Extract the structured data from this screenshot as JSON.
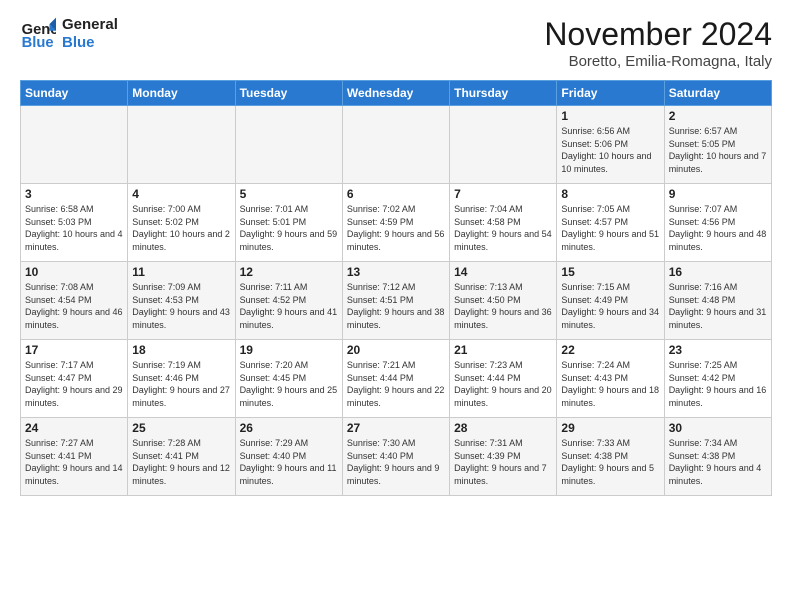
{
  "logo": {
    "line1": "General",
    "line2": "Blue"
  },
  "title": "November 2024",
  "location": "Boretto, Emilia-Romagna, Italy",
  "days_of_week": [
    "Sunday",
    "Monday",
    "Tuesday",
    "Wednesday",
    "Thursday",
    "Friday",
    "Saturday"
  ],
  "weeks": [
    [
      {
        "num": "",
        "info": ""
      },
      {
        "num": "",
        "info": ""
      },
      {
        "num": "",
        "info": ""
      },
      {
        "num": "",
        "info": ""
      },
      {
        "num": "",
        "info": ""
      },
      {
        "num": "1",
        "info": "Sunrise: 6:56 AM\nSunset: 5:06 PM\nDaylight: 10 hours and 10 minutes."
      },
      {
        "num": "2",
        "info": "Sunrise: 6:57 AM\nSunset: 5:05 PM\nDaylight: 10 hours and 7 minutes."
      }
    ],
    [
      {
        "num": "3",
        "info": "Sunrise: 6:58 AM\nSunset: 5:03 PM\nDaylight: 10 hours and 4 minutes."
      },
      {
        "num": "4",
        "info": "Sunrise: 7:00 AM\nSunset: 5:02 PM\nDaylight: 10 hours and 2 minutes."
      },
      {
        "num": "5",
        "info": "Sunrise: 7:01 AM\nSunset: 5:01 PM\nDaylight: 9 hours and 59 minutes."
      },
      {
        "num": "6",
        "info": "Sunrise: 7:02 AM\nSunset: 4:59 PM\nDaylight: 9 hours and 56 minutes."
      },
      {
        "num": "7",
        "info": "Sunrise: 7:04 AM\nSunset: 4:58 PM\nDaylight: 9 hours and 54 minutes."
      },
      {
        "num": "8",
        "info": "Sunrise: 7:05 AM\nSunset: 4:57 PM\nDaylight: 9 hours and 51 minutes."
      },
      {
        "num": "9",
        "info": "Sunrise: 7:07 AM\nSunset: 4:56 PM\nDaylight: 9 hours and 48 minutes."
      }
    ],
    [
      {
        "num": "10",
        "info": "Sunrise: 7:08 AM\nSunset: 4:54 PM\nDaylight: 9 hours and 46 minutes."
      },
      {
        "num": "11",
        "info": "Sunrise: 7:09 AM\nSunset: 4:53 PM\nDaylight: 9 hours and 43 minutes."
      },
      {
        "num": "12",
        "info": "Sunrise: 7:11 AM\nSunset: 4:52 PM\nDaylight: 9 hours and 41 minutes."
      },
      {
        "num": "13",
        "info": "Sunrise: 7:12 AM\nSunset: 4:51 PM\nDaylight: 9 hours and 38 minutes."
      },
      {
        "num": "14",
        "info": "Sunrise: 7:13 AM\nSunset: 4:50 PM\nDaylight: 9 hours and 36 minutes."
      },
      {
        "num": "15",
        "info": "Sunrise: 7:15 AM\nSunset: 4:49 PM\nDaylight: 9 hours and 34 minutes."
      },
      {
        "num": "16",
        "info": "Sunrise: 7:16 AM\nSunset: 4:48 PM\nDaylight: 9 hours and 31 minutes."
      }
    ],
    [
      {
        "num": "17",
        "info": "Sunrise: 7:17 AM\nSunset: 4:47 PM\nDaylight: 9 hours and 29 minutes."
      },
      {
        "num": "18",
        "info": "Sunrise: 7:19 AM\nSunset: 4:46 PM\nDaylight: 9 hours and 27 minutes."
      },
      {
        "num": "19",
        "info": "Sunrise: 7:20 AM\nSunset: 4:45 PM\nDaylight: 9 hours and 25 minutes."
      },
      {
        "num": "20",
        "info": "Sunrise: 7:21 AM\nSunset: 4:44 PM\nDaylight: 9 hours and 22 minutes."
      },
      {
        "num": "21",
        "info": "Sunrise: 7:23 AM\nSunset: 4:44 PM\nDaylight: 9 hours and 20 minutes."
      },
      {
        "num": "22",
        "info": "Sunrise: 7:24 AM\nSunset: 4:43 PM\nDaylight: 9 hours and 18 minutes."
      },
      {
        "num": "23",
        "info": "Sunrise: 7:25 AM\nSunset: 4:42 PM\nDaylight: 9 hours and 16 minutes."
      }
    ],
    [
      {
        "num": "24",
        "info": "Sunrise: 7:27 AM\nSunset: 4:41 PM\nDaylight: 9 hours and 14 minutes."
      },
      {
        "num": "25",
        "info": "Sunrise: 7:28 AM\nSunset: 4:41 PM\nDaylight: 9 hours and 12 minutes."
      },
      {
        "num": "26",
        "info": "Sunrise: 7:29 AM\nSunset: 4:40 PM\nDaylight: 9 hours and 11 minutes."
      },
      {
        "num": "27",
        "info": "Sunrise: 7:30 AM\nSunset: 4:40 PM\nDaylight: 9 hours and 9 minutes."
      },
      {
        "num": "28",
        "info": "Sunrise: 7:31 AM\nSunset: 4:39 PM\nDaylight: 9 hours and 7 minutes."
      },
      {
        "num": "29",
        "info": "Sunrise: 7:33 AM\nSunset: 4:38 PM\nDaylight: 9 hours and 5 minutes."
      },
      {
        "num": "30",
        "info": "Sunrise: 7:34 AM\nSunset: 4:38 PM\nDaylight: 9 hours and 4 minutes."
      }
    ]
  ]
}
